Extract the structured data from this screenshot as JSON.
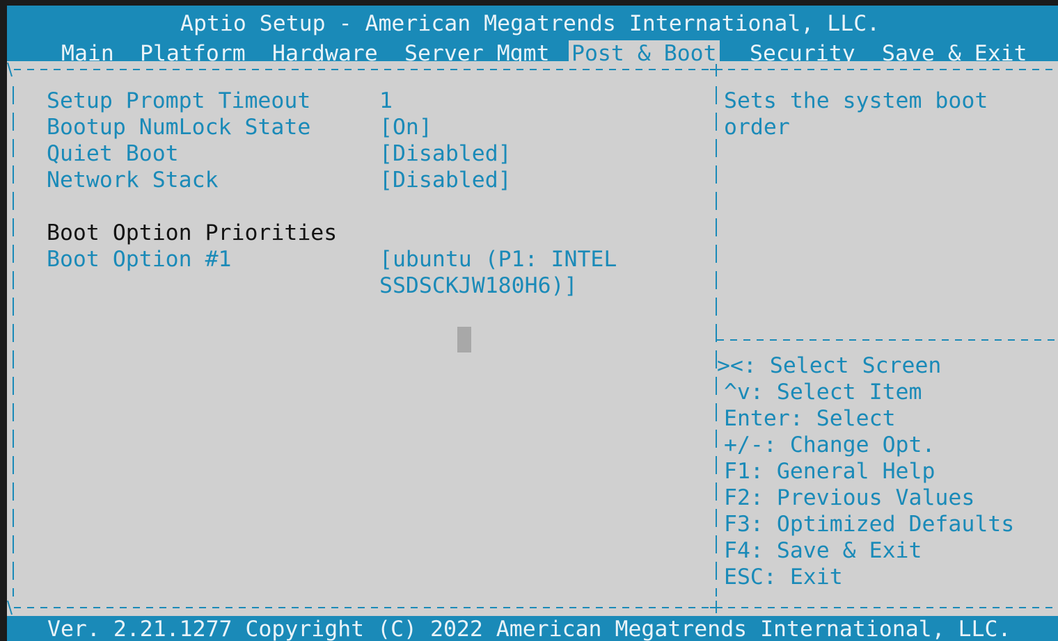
{
  "header": {
    "title": "Aptio Setup - American Megatrends International, LLC.",
    "tabs": [
      "Main",
      "Platform",
      "Hardware",
      "Server Mgmt",
      "Post & Boot",
      "Security",
      "Save & Exit"
    ],
    "active_tab": "Post & Boot"
  },
  "settings": [
    {
      "label": "Setup Prompt Timeout",
      "value": "1"
    },
    {
      "label": "Bootup NumLock State",
      "value": "[On]"
    },
    {
      "label": "Quiet Boot",
      "value": "[Disabled]"
    },
    {
      "label": "Network Stack",
      "value": "[Disabled]"
    }
  ],
  "boot_section": {
    "heading": "Boot Option Priorities",
    "option1_label": "Boot Option #1",
    "option1_value_line1": "[ubuntu (P1: INTEL",
    "option1_value_line2": "SSDSCKJW180H6)]"
  },
  "help": {
    "line1": "Sets the system boot",
    "line2": "order"
  },
  "keys": [
    "><: Select Screen",
    "^v: Select Item",
    "Enter: Select",
    "+/-: Change Opt.",
    "F1: General Help",
    "F2: Previous Values",
    "F3: Optimized Defaults",
    "F4: Save & Exit",
    "ESC: Exit"
  ],
  "footer": "Ver. 2.21.1277 Copyright (C) 2022 American Megatrends International, LLC.",
  "colors": {
    "accent": "#1a8ab8",
    "panel_bg": "#d0d0d0",
    "heading_text": "#121212"
  }
}
